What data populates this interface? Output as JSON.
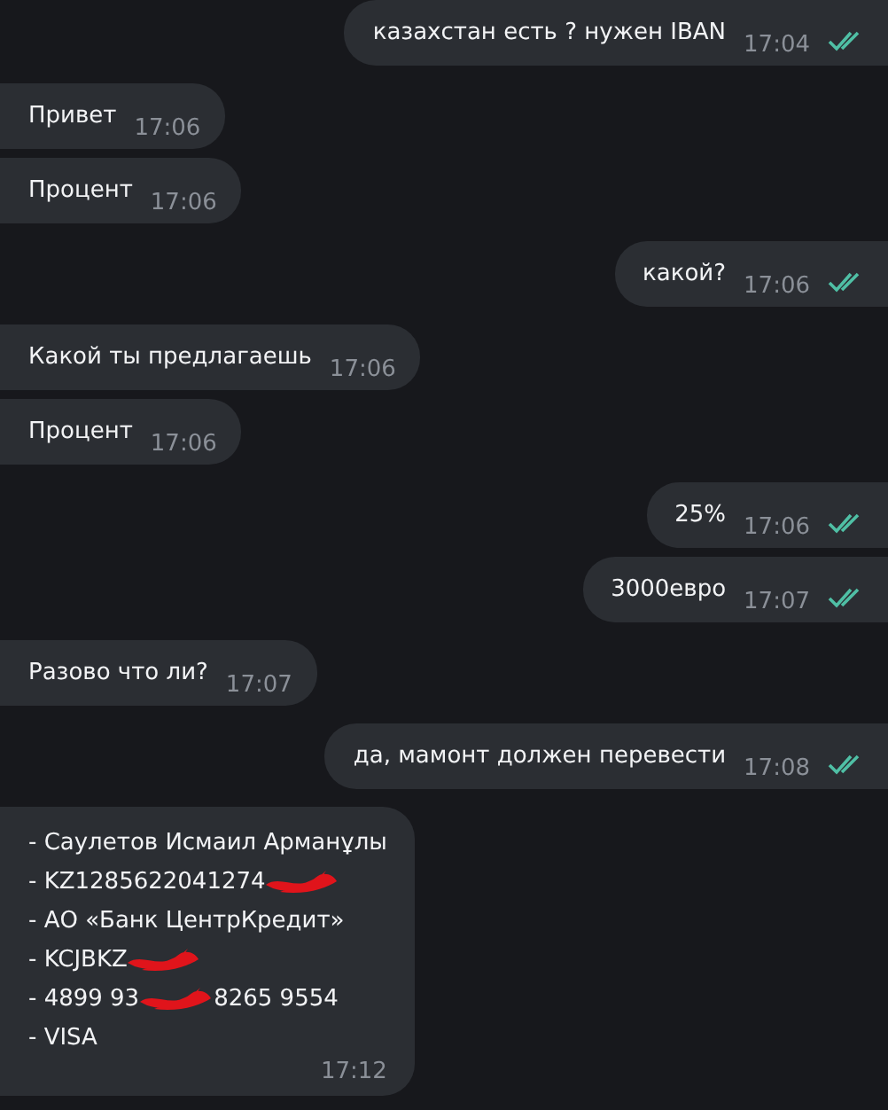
{
  "messages": [
    {
      "kind": "outgoing",
      "text": "казахстан есть ? нужен IBAN",
      "time": "17:04",
      "read": true
    },
    {
      "kind": "incoming",
      "text": "Привет",
      "time": "17:06"
    },
    {
      "kind": "incoming",
      "text": "Процент",
      "time": "17:06"
    },
    {
      "kind": "outgoing",
      "text": "какой?",
      "time": "17:06",
      "read": true
    },
    {
      "kind": "incoming",
      "text": "Какой ты предлагаешь",
      "time": "17:06"
    },
    {
      "kind": "incoming",
      "text": "Процент",
      "time": "17:06"
    },
    {
      "kind": "outgoing",
      "text": "25%",
      "time": "17:06",
      "read": true
    },
    {
      "kind": "outgoing",
      "text": "3000евро",
      "time": "17:07",
      "read": true
    },
    {
      "kind": "incoming",
      "text": "Разово что ли?",
      "time": "17:07"
    },
    {
      "kind": "outgoing",
      "text": "да, мамонт должен перевести",
      "time": "17:08",
      "read": true
    },
    {
      "kind": "incoming",
      "time": "17:12",
      "lines": [
        {
          "parts": [
            {
              "kind": "text",
              "text": "- Саулетов Исмаил Арманұлы"
            }
          ]
        },
        {
          "parts": [
            {
              "kind": "text",
              "text": "- KZ1285622041274"
            },
            {
              "kind": "redaction"
            }
          ]
        },
        {
          "parts": [
            {
              "kind": "text",
              "text": "- АО «Банк ЦентрКредит»"
            }
          ]
        },
        {
          "parts": [
            {
              "kind": "text",
              "text": "- KCJBKZ"
            },
            {
              "kind": "redaction"
            }
          ]
        },
        {
          "parts": [
            {
              "kind": "text",
              "text": "- 4899 93"
            },
            {
              "kind": "redaction"
            },
            {
              "kind": "text",
              "text": "8265 9554"
            }
          ]
        },
        {
          "parts": [
            {
              "kind": "text",
              "text": "- VISA"
            }
          ]
        }
      ]
    }
  ]
}
